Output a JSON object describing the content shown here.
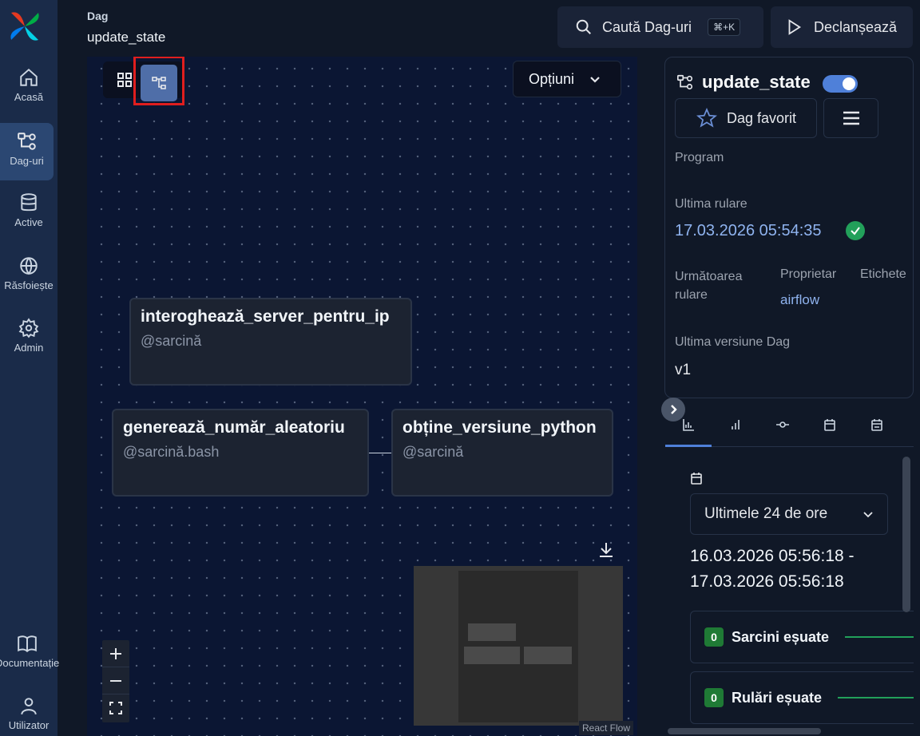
{
  "sidebar": {
    "items": [
      {
        "label": "Acasă",
        "icon": "home-icon"
      },
      {
        "label": "Dag-uri",
        "icon": "dag-icon",
        "active": true
      },
      {
        "label": "Active",
        "icon": "database-icon"
      },
      {
        "label": "Răsfoiește",
        "icon": "globe-icon"
      },
      {
        "label": "Admin",
        "icon": "gear-icon"
      },
      {
        "label": "Documentație",
        "icon": "book-icon"
      },
      {
        "label": "Utilizator",
        "icon": "user-icon"
      }
    ]
  },
  "header": {
    "section": "Dag",
    "title": "update_state",
    "search_label": "Caută Dag-uri",
    "search_shortcut": "⌘+K",
    "trigger_label": "Declanșează"
  },
  "graph": {
    "options_label": "Opțiuni",
    "nodes": [
      {
        "name": "interoghează_server_pentru_ip",
        "type": "@sarcină"
      },
      {
        "name": "generează_număr_aleatoriu",
        "type": "@sarcină.bash"
      },
      {
        "name": "obține_versiune_python",
        "type": "@sarcină"
      }
    ],
    "attribution": "React Flow"
  },
  "details": {
    "dag_name": "update_state",
    "paused": false,
    "favorite_label": "Dag favorit",
    "schedule_label": "Program",
    "last_run_label": "Ultima rulare",
    "last_run_value": "17.03.2026 05:54:35",
    "last_run_status": "success",
    "next_run_label": "Următoarea rulare",
    "owner_label": "Proprietar",
    "owner_value": "airflow",
    "tags_label": "Etichete",
    "version_label": "Ultima versiune Dag",
    "version_value": "v1"
  },
  "overview": {
    "range_select": "Ultimele 24 de ore",
    "range_start": "16.03.2026 05:56:18 -",
    "range_end": "17.03.2026 05:56:18",
    "stats": [
      {
        "count": "0",
        "label": "Sarcini eșuate"
      },
      {
        "count": "0",
        "label": "Rulări eșuate"
      }
    ]
  },
  "colors": {
    "accent": "#4f80d9",
    "success": "#22a05a",
    "highlight": "#e01e1e"
  }
}
